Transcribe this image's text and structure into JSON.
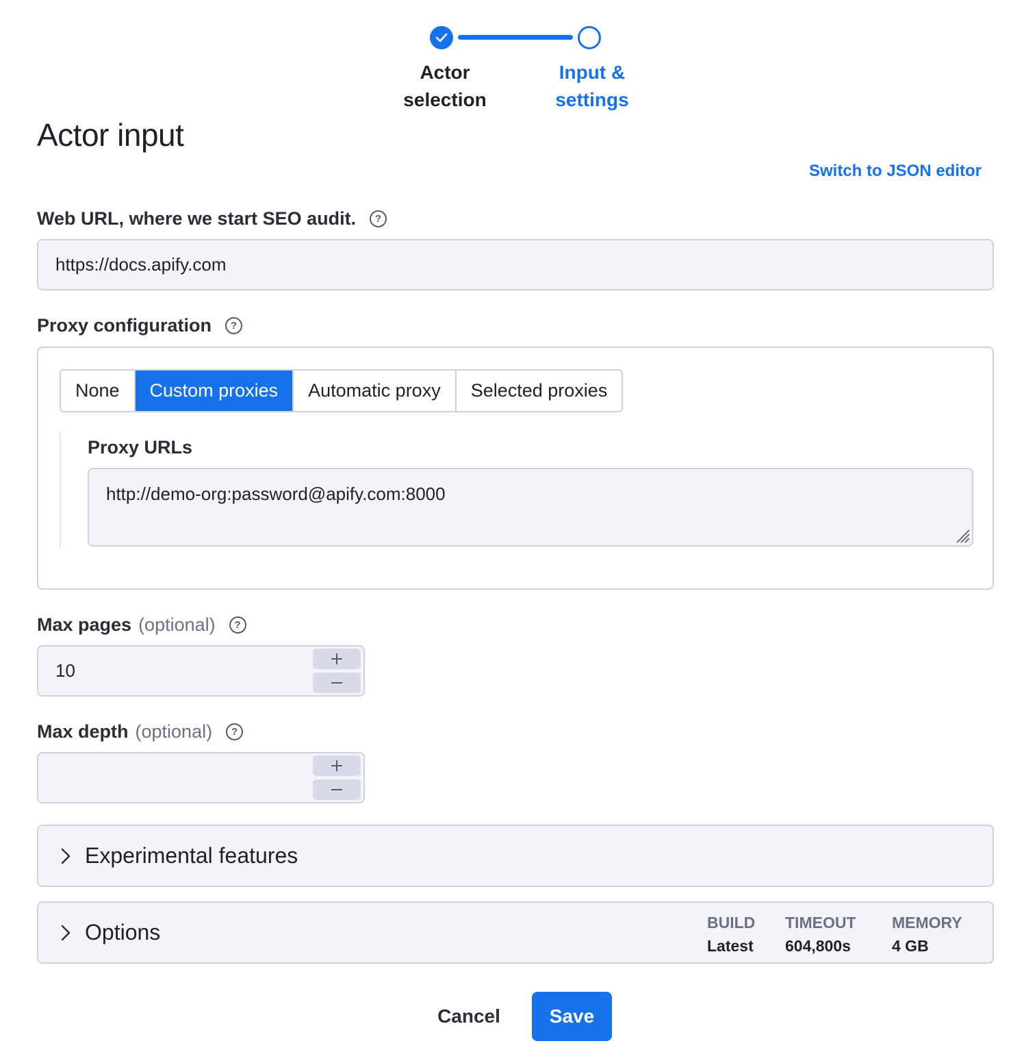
{
  "stepper": {
    "steps": [
      {
        "label_line1": "Actor",
        "label_line2": "selection",
        "state": "done"
      },
      {
        "label_line1": "Input &",
        "label_line2": "settings",
        "state": "current"
      }
    ]
  },
  "page": {
    "title": "Actor input",
    "json_editor_link": "Switch to JSON editor"
  },
  "fields": {
    "start_url": {
      "label": "Web URL, where we start SEO audit.",
      "value": "https://docs.apify.com"
    },
    "proxy": {
      "label": "Proxy configuration",
      "options": [
        "None",
        "Custom proxies",
        "Automatic proxy",
        "Selected proxies"
      ],
      "selected": "Custom proxies",
      "urls_label": "Proxy URLs",
      "urls_value": "http://demo-org:password@apify.com:8000"
    },
    "max_pages": {
      "label": "Max pages",
      "optional": "(optional)",
      "value": "10"
    },
    "max_depth": {
      "label": "Max depth",
      "optional": "(optional)",
      "value": ""
    }
  },
  "sections": {
    "experimental": {
      "title": "Experimental features"
    },
    "options": {
      "title": "Options",
      "meta": [
        {
          "key": "BUILD",
          "value": "Latest"
        },
        {
          "key": "TIMEOUT",
          "value": "604,800s"
        },
        {
          "key": "MEMORY",
          "value": "4 GB"
        }
      ]
    }
  },
  "footer": {
    "cancel_label": "Cancel",
    "save_label": "Save"
  },
  "colors": {
    "accent": "#1672eb",
    "input_bg": "#f3f4fa",
    "border": "#cfd2dc"
  }
}
